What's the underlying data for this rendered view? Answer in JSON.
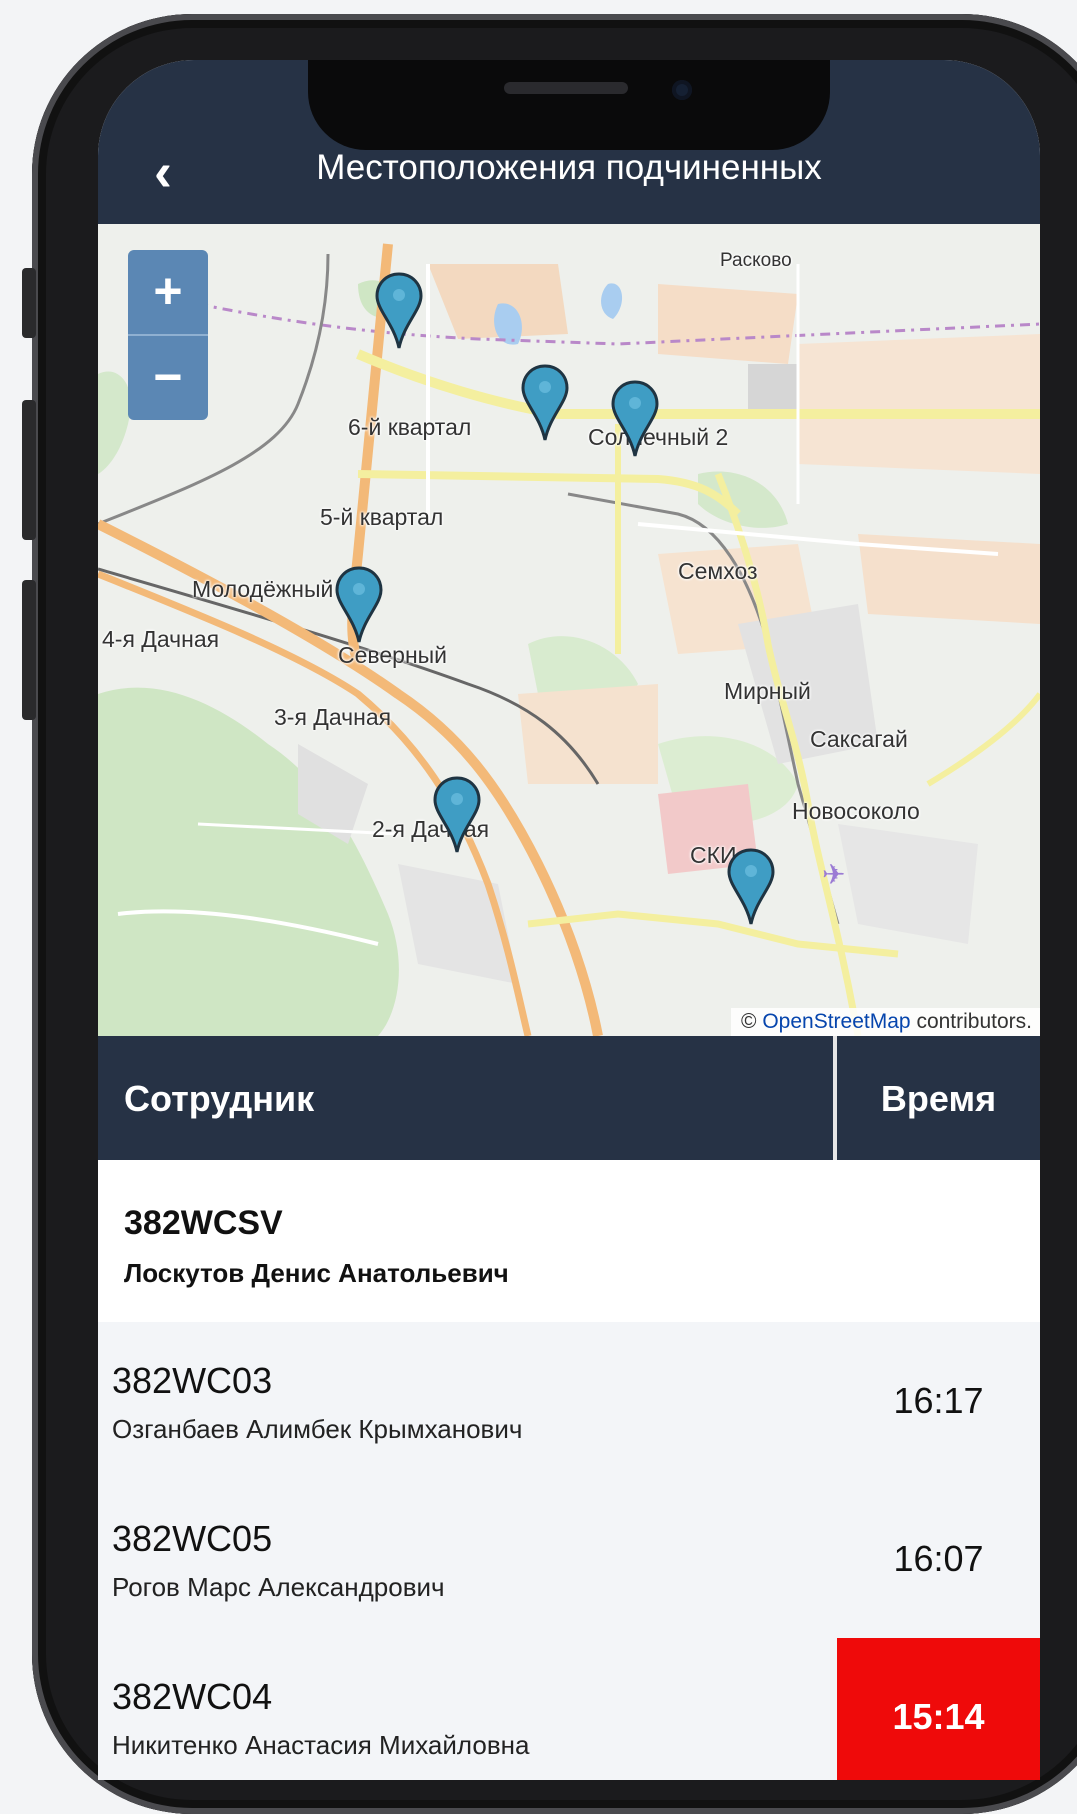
{
  "header": {
    "title": "Местоположения подчиненных"
  },
  "map": {
    "zoom_in": "+",
    "zoom_out": "−",
    "labels": {
      "raskovo": "Расково",
      "kvartal6": "6-й квартал",
      "solnechny2": "Солнечный 2",
      "kvartal5": "5-й квартал",
      "semhoz": "Семхоз",
      "molodezhny": "Молодёжный",
      "dachnaya4": "4-я Дачная",
      "severny": "Северный",
      "mirny": "Мирный",
      "dachnaya3": "3-я Дачная",
      "saksagay": "Саксагай",
      "novosokolo": "Новосоколо",
      "dachnaya2": "2-я Дачная",
      "ski": "СКИ"
    },
    "attribution": {
      "prefix": "© ",
      "link": "OpenStreetMap",
      "suffix": " contributors."
    },
    "pin_color": "#3f9dc4"
  },
  "table": {
    "col_employee": "Сотрудник",
    "col_time": "Время",
    "group": {
      "code": "382WCSV",
      "name": "Лоскутов Денис Анатольевич"
    },
    "rows": [
      {
        "code": "382WC03",
        "name": "Озганбаев Алимбек Крымханович",
        "time": "16:17",
        "late": false
      },
      {
        "code": "382WC05",
        "name": "Рогов Марс Александрович",
        "time": "16:07",
        "late": false
      },
      {
        "code": "382WC04",
        "name": "Никитенко Анастасия Михайловна",
        "time": "15:14",
        "late": true
      }
    ]
  },
  "colors": {
    "header_bg": "#263245",
    "late": "#ef0a0a"
  }
}
